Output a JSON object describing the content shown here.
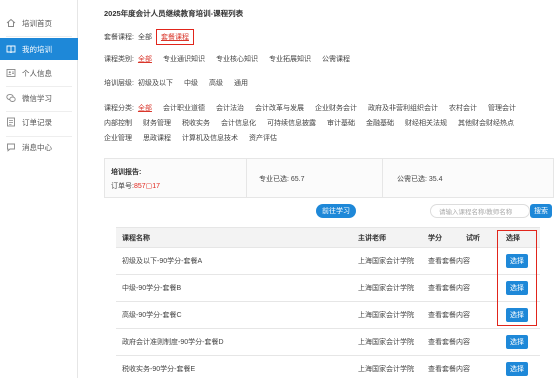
{
  "sidebar": {
    "items": [
      {
        "label": "培训首页",
        "icon": "home-icon"
      },
      {
        "label": "我的培训",
        "icon": "book-icon",
        "active": true
      },
      {
        "label": "个人信息",
        "icon": "user-icon"
      },
      {
        "label": "微信学习",
        "icon": "wechat-icon"
      },
      {
        "label": "订单记录",
        "icon": "order-icon"
      },
      {
        "label": "消息中心",
        "icon": "message-icon"
      }
    ]
  },
  "page": {
    "title": "2025年度会计人员继续教育培训-课程列表"
  },
  "package": {
    "label": "套餐课程:",
    "options": [
      "全部",
      "套餐课程"
    ]
  },
  "category": {
    "label": "课程类别:",
    "options": [
      "全部",
      "专业通识知识",
      "专业核心知识",
      "专业拓展知识",
      "公需课程"
    ]
  },
  "level": {
    "label": "培训层级:",
    "options": [
      "初级及以下",
      "中级",
      "高级",
      "通用"
    ]
  },
  "classify": {
    "label": "课程分类:",
    "row1": [
      "全部",
      "会计职业道德",
      "会计法治",
      "会计改革与发展",
      "企业财务会计",
      "政府及非营利组织会计",
      "农村会计",
      "管理会计"
    ],
    "row2": [
      "内部控制",
      "财务管理",
      "税收实务",
      "会计信息化",
      "可持续信息披露",
      "审计基础",
      "金融基础",
      "财经相关法规",
      "其他财会财经热点"
    ],
    "row3": [
      "企业管理",
      "思政课程",
      "计算机及信息技术",
      "资产评估"
    ]
  },
  "report": {
    "title": "培训报告:",
    "order_label": "订单号:",
    "order_num": "857▢17",
    "professional": "专业已选: 65.7",
    "public": "公需已选: 35.4"
  },
  "actions": {
    "go_study": "前往学习",
    "search_placeholder": "请输入课程名称/教师名称",
    "search": "搜索"
  },
  "table": {
    "headers": [
      "课程名称",
      "主讲老师",
      "学分",
      "试听",
      "选择"
    ],
    "rows": [
      {
        "name": "初级及以下-90学分-套餐A",
        "teacher": "上海国家会计学院",
        "credit": "查看套餐内容",
        "button": "选择"
      },
      {
        "name": "中级-90学分-套餐B",
        "teacher": "上海国家会计学院",
        "credit": "查看套餐内容",
        "button": "选择"
      },
      {
        "name": "高级-90学分-套餐C",
        "teacher": "上海国家会计学院",
        "credit": "查看套餐内容",
        "button": "选择"
      },
      {
        "name": "政府会计准则制度-90学分-套餐D",
        "teacher": "上海国家会计学院",
        "credit": "查看套餐内容",
        "button": "选择"
      },
      {
        "name": "税收实务-90学分-套餐E",
        "teacher": "上海国家会计学院",
        "credit": "查看套餐内容",
        "button": "选择"
      }
    ]
  },
  "colors": {
    "accent": "#1e88d8",
    "highlight": "#e1251b"
  }
}
